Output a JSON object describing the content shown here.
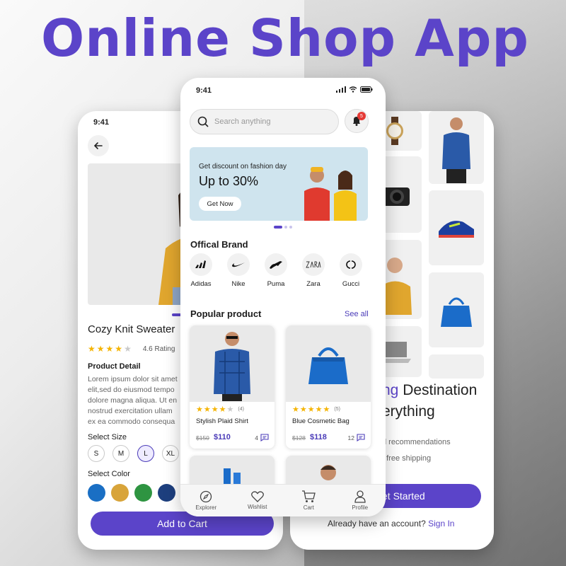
{
  "headline": "Online Shop App",
  "colors": {
    "accent": "#5b44c9",
    "star": "#f5b400",
    "badge": "#e53935"
  },
  "left_phone": {
    "time": "9:41",
    "product_title": "Cozy Knit Sweater",
    "rating_text": "4.6 Rating",
    "rating_stars": 4,
    "product_detail_label": "Product Detail",
    "description": "Lorem ipsum dolor sit amet\n elit,sed do eiusmod tempo\ndolore magna aliqua. Ut en\n nostrud exercitation ullam\n ex ea commodo consequa",
    "select_size_label": "Select Size",
    "sizes": [
      "S",
      "M",
      "L",
      "XL"
    ],
    "selected_size": "L",
    "select_color_label": "Select Color",
    "colors": [
      "#1a6fc4",
      "#d8a43a",
      "#2e9441",
      "#1d3f7e",
      "#9ab0c7"
    ],
    "add_to_cart": "Add to Cart"
  },
  "center_phone": {
    "time": "9:41",
    "search": {
      "placeholder": "Search anything"
    },
    "notification_count": "5",
    "banner": {
      "subtitle": "Get discount on fashion day",
      "title": "Up to 30%",
      "button": "Get Now"
    },
    "brands_title": "Offical Brand",
    "brands": [
      {
        "name": "Adidas",
        "icon": "adidas-logo"
      },
      {
        "name": "Nike",
        "icon": "nike-logo"
      },
      {
        "name": "Puma",
        "icon": "puma-logo"
      },
      {
        "name": "Zara",
        "icon": "zara-logo"
      },
      {
        "name": "Gucci",
        "icon": "gucci-logo"
      }
    ],
    "popular_title": "Popular product",
    "see_all": "See all",
    "products": [
      {
        "name": "Stylish Plaid Shirt",
        "stars": 4,
        "review_count": "(4)",
        "old_price": "$150",
        "price": "$110",
        "comments": "4"
      },
      {
        "name": "Blue Cosmetic Bag",
        "stars": 5,
        "review_count": "(5)",
        "old_price": "$128",
        "price": "$118",
        "comments": "12"
      }
    ],
    "nav": [
      {
        "label": "Explorer",
        "icon": "compass-icon"
      },
      {
        "label": "Wishlist",
        "icon": "heart-icon"
      },
      {
        "label": "Cart",
        "icon": "cart-icon"
      },
      {
        "label": "Profile",
        "icon": "user-icon"
      }
    ]
  },
  "right_phone": {
    "title_accent": "ng",
    "title_rest": " Destination",
    "title_line2": "erything",
    "bullet1": "d recommendations",
    "bullet2": ", free shipping",
    "get_started": "et Started",
    "signin_text": "Already have an account? ",
    "signin_link": "Sign In"
  }
}
